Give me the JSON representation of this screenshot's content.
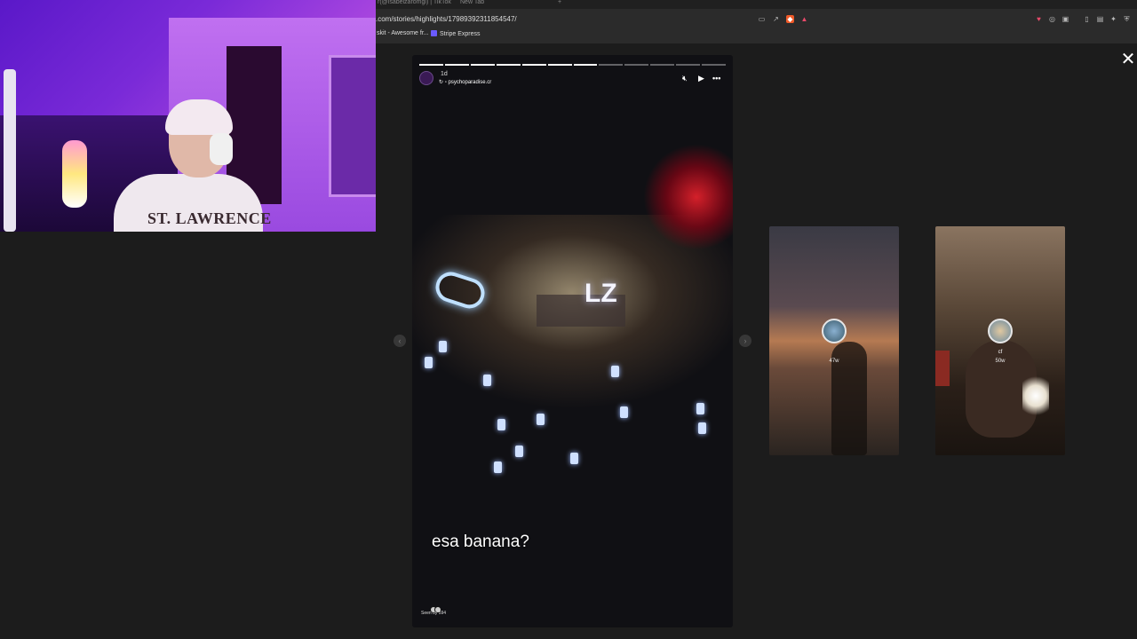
{
  "browser": {
    "tabs": [
      {
        "label": "r(@isabelzaromgi) | TikTok"
      },
      {
        "label": "New Tab"
      }
    ],
    "url": ".com/stories/highlights/17989392311854547/",
    "bookmarks": [
      {
        "label": "skit - Awesome fr..."
      },
      {
        "label": "Stripe Express"
      }
    ]
  },
  "webcam": {
    "shirt_text": "ST. LAWRENCE"
  },
  "story": {
    "time": "1d",
    "username": "psychoparadise.cr",
    "caption": "esa banana?",
    "seen_by": "Seen by 594",
    "progress_total": 12,
    "progress_done": 7
  },
  "previews": [
    {
      "name": "",
      "time": "47w"
    },
    {
      "name": "cf",
      "time": "50w"
    }
  ],
  "icons": {
    "close": "close-icon",
    "mute": "mute-icon",
    "play": "play-icon",
    "more": "more-icon"
  }
}
